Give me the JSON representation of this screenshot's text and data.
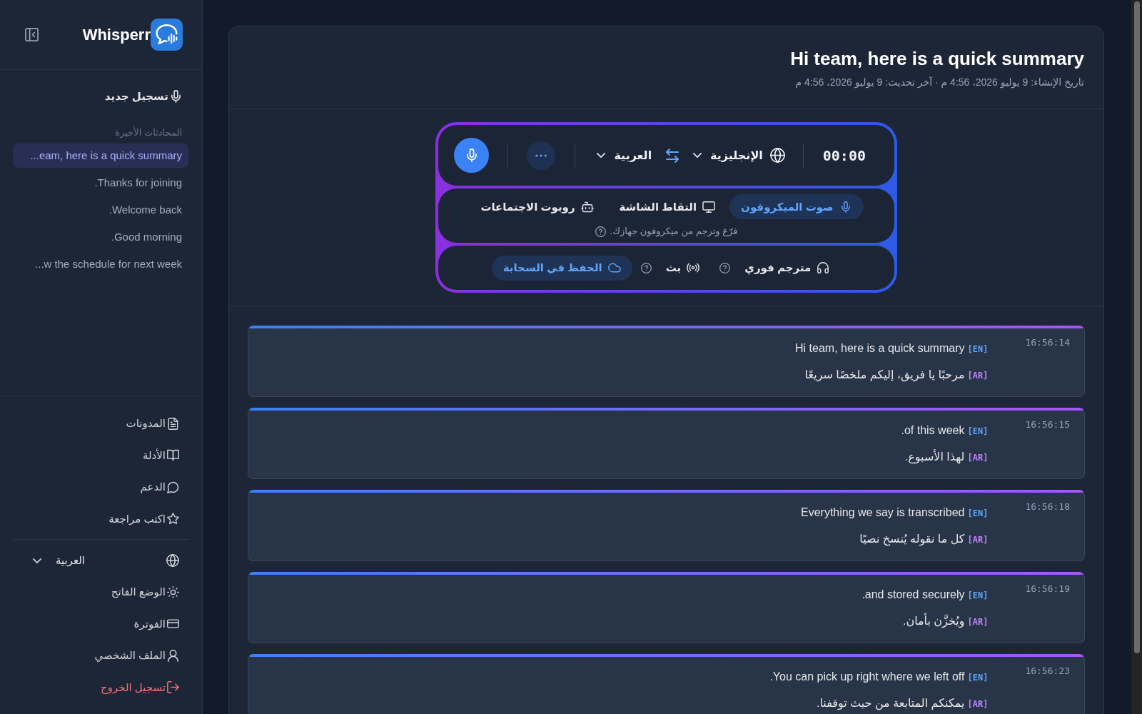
{
  "sidebar": {
    "logo": "Whisperr",
    "new_recording": "تسجيل جديد",
    "recent_heading": "المحادثات الأخيرة",
    "recent": [
      {
        "label": "...eam, here is a quick summary",
        "selected": true
      },
      {
        "label": ".Thanks for joining",
        "selected": false
      },
      {
        "label": ".Welcome back",
        "selected": false
      },
      {
        "label": ".Good morning",
        "selected": false
      },
      {
        "label": "...w the schedule for next week",
        "selected": false
      }
    ],
    "links": [
      {
        "label": "المدونات"
      },
      {
        "label": "الأدلة"
      },
      {
        "label": "الدعم"
      },
      {
        "label": "اكتب مراجعة"
      }
    ],
    "language": "العربية",
    "account": [
      {
        "label": "الوضع الفاتح",
        "kind": "normal"
      },
      {
        "label": "الفوترة",
        "kind": "normal"
      },
      {
        "label": "الملف الشخصي",
        "kind": "normal"
      },
      {
        "label": "تسجيل الخروج",
        "kind": "danger"
      }
    ]
  },
  "conversation": {
    "title": "Hi team, here is a quick summary",
    "meta": "تاريخ الإنشاء: 9 يوليو 2026، 4:56 م · آخر تحديث: 9 يوليو 2026، 4:56 م"
  },
  "recorder": {
    "timer": "00:00",
    "source_language": "الإنجليزية",
    "target_language": "العربية",
    "sources": [
      {
        "label": "صوت الميكروفون",
        "selected": true
      },
      {
        "label": "التقاط الشاشة",
        "selected": false
      },
      {
        "label": "روبوت الاجتماعات",
        "selected": false
      }
    ],
    "hint": "فرّغ وترجم من ميكروفون جهازك.",
    "options": [
      {
        "label": "مترجم فوري",
        "on": false,
        "help": true
      },
      {
        "label": "بث",
        "on": false,
        "help": true
      },
      {
        "label": "الحفظ في السحابة",
        "on": true,
        "help": false
      }
    ]
  },
  "transcript": [
    {
      "time": "16:56:14",
      "lines": [
        {
          "tag": "[EN]",
          "text": "Hi team, here is a quick summary",
          "color": "#60a5fa"
        },
        {
          "tag": "[AR]",
          "text": "مرحبًا يا فريق، إليكم ملخصًا سريعًا",
          "color": "#c084fc"
        }
      ]
    },
    {
      "time": "16:56:15",
      "lines": [
        {
          "tag": "[EN]",
          "text": ".of this week",
          "color": "#60a5fa"
        },
        {
          "tag": "[AR]",
          "text": "لهذا الأسبوع.",
          "color": "#c084fc"
        }
      ]
    },
    {
      "time": "16:56:18",
      "lines": [
        {
          "tag": "[EN]",
          "text": "Everything we say is transcribed",
          "color": "#60a5fa"
        },
        {
          "tag": "[AR]",
          "text": "كل ما نقوله يُنسخ نصيًا",
          "color": "#c084fc"
        }
      ]
    },
    {
      "time": "16:56:19",
      "lines": [
        {
          "tag": "[EN]",
          "text": ".and stored securely",
          "color": "#60a5fa"
        },
        {
          "tag": "[AR]",
          "text": "ويُخزَّن بأمان.",
          "color": "#c084fc"
        }
      ]
    },
    {
      "time": "16:56:23",
      "lines": [
        {
          "tag": "[EN]",
          "text": ".You can pick up right where we left off",
          "color": "#60a5fa"
        },
        {
          "tag": "[AR]",
          "text": "يمكنكم المتابعة من حيث توقفنا.",
          "color": "#c084fc"
        }
      ]
    }
  ]
}
